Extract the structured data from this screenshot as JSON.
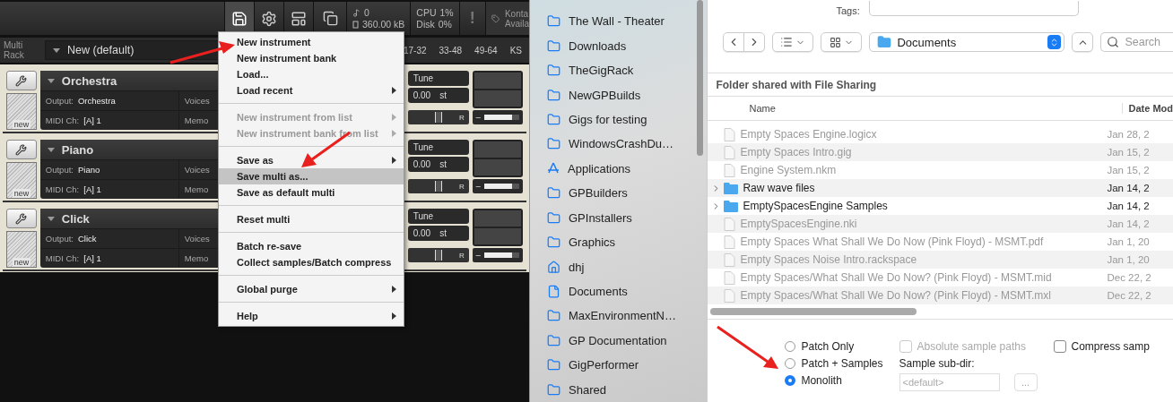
{
  "kontakt": {
    "toolbar": {
      "voices": "0",
      "memory": "360.00 kB",
      "cpu_label": "CPU",
      "cpu": "1%",
      "disk_label": "Disk",
      "disk": "0%",
      "warning": "!",
      "license_lines": [
        "Konta",
        "Availa"
      ],
      "save_active": true
    },
    "rack_label": "Multi Rack",
    "multi_name": "New (default)",
    "pages": [
      "17-32",
      "33-48",
      "49-64",
      "KS"
    ],
    "instruments": [
      {
        "name": "Orchestra",
        "output_label": "Output:",
        "output": "Orchestra",
        "voices_label": "Voices",
        "midi_label": "MIDI Ch:",
        "midi": "[A]  1",
        "memory_label": "Memo",
        "new_label": "new",
        "tune_label": "Tune",
        "tune": "0.00",
        "tune_unit": "st",
        "pan": {
          "label": "R",
          "level": 0.5
        },
        "volume": {
          "sign": "–",
          "level": 0.8
        }
      },
      {
        "name": "Piano",
        "output_label": "Output:",
        "output": "Piano",
        "voices_label": "Voices",
        "midi_label": "MIDI Ch:",
        "midi": "[A]  1",
        "memory_label": "Memo",
        "new_label": "new",
        "tune_label": "Tune",
        "tune": "0.00",
        "tune_unit": "st",
        "pan": {
          "label": "R",
          "level": 0.5
        },
        "volume": {
          "sign": "–",
          "level": 0.8
        }
      },
      {
        "name": "Click",
        "output_label": "Output:",
        "output": "Click",
        "voices_label": "Voices",
        "midi_label": "MIDI Ch:",
        "midi": "[A]  1",
        "memory_label": "Memo",
        "new_label": "new",
        "tune_label": "Tune",
        "tune": "0.00",
        "tune_unit": "st",
        "pan": {
          "label": "R",
          "level": 0.5
        },
        "volume": {
          "sign": "–",
          "level": 0.8
        }
      }
    ]
  },
  "menu": {
    "items": [
      {
        "kind": "item",
        "label": "New instrument",
        "disabled": false,
        "submenu": false,
        "selected": false
      },
      {
        "kind": "item",
        "label": "New instrument bank",
        "disabled": false,
        "submenu": false,
        "selected": false
      },
      {
        "kind": "item",
        "label": "Load...",
        "disabled": false,
        "submenu": false,
        "selected": false
      },
      {
        "kind": "item",
        "label": "Load recent",
        "disabled": false,
        "submenu": true,
        "selected": false
      },
      {
        "kind": "separator"
      },
      {
        "kind": "item",
        "label": "New instrument from list",
        "disabled": true,
        "submenu": true,
        "selected": false
      },
      {
        "kind": "item",
        "label": "New instrument bank from list",
        "disabled": true,
        "submenu": true,
        "selected": false
      },
      {
        "kind": "separator"
      },
      {
        "kind": "item",
        "label": "Save as",
        "disabled": false,
        "submenu": true,
        "selected": false
      },
      {
        "kind": "item",
        "label": "Save multi as...",
        "disabled": false,
        "submenu": false,
        "selected": true
      },
      {
        "kind": "item",
        "label": "Save as default multi",
        "disabled": false,
        "submenu": false,
        "selected": false
      },
      {
        "kind": "separator"
      },
      {
        "kind": "item",
        "label": "Reset multi",
        "disabled": false,
        "submenu": false,
        "selected": false
      },
      {
        "kind": "separator"
      },
      {
        "kind": "item",
        "label": "Batch re-save",
        "disabled": false,
        "submenu": false,
        "selected": false
      },
      {
        "kind": "item",
        "label": "Collect samples/Batch compress",
        "disabled": false,
        "submenu": false,
        "selected": false
      },
      {
        "kind": "separator"
      },
      {
        "kind": "item",
        "label": "Global purge",
        "disabled": false,
        "submenu": true,
        "selected": false
      },
      {
        "kind": "separator"
      },
      {
        "kind": "item",
        "label": "Help",
        "disabled": false,
        "submenu": true,
        "selected": false
      }
    ]
  },
  "sidebar": {
    "items": [
      {
        "kind": "folder",
        "label": "The Wall - Theater"
      },
      {
        "kind": "folder",
        "label": "Downloads"
      },
      {
        "kind": "folder",
        "label": "TheGigRack"
      },
      {
        "kind": "folder",
        "label": "NewGPBuilds"
      },
      {
        "kind": "folder",
        "label": "Gigs for testing"
      },
      {
        "kind": "folder",
        "label": "WindowsCrashDu…"
      },
      {
        "kind": "apps",
        "label": "Applications"
      },
      {
        "kind": "folder",
        "label": "GPBuilders"
      },
      {
        "kind": "folder",
        "label": "GPInstallers"
      },
      {
        "kind": "folder",
        "label": "Graphics"
      },
      {
        "kind": "home",
        "label": "dhj"
      },
      {
        "kind": "document",
        "label": "Documents"
      },
      {
        "kind": "folder",
        "label": "MaxEnvironmentN…"
      },
      {
        "kind": "folder",
        "label": "GP Documentation"
      },
      {
        "kind": "folder",
        "label": "GigPerformer"
      },
      {
        "kind": "folder",
        "label": "Shared"
      }
    ]
  },
  "dialog": {
    "tags_label": "Tags:",
    "location": "Documents",
    "search_placeholder": "Search",
    "section_title": "Folder shared with File Sharing",
    "columns": [
      "Name",
      "Date Mod"
    ],
    "rows": [
      {
        "kind": "file",
        "name": "Empty Spaces Engine.logicx",
        "date": "Jan 28, 2",
        "disabled": true
      },
      {
        "kind": "file",
        "name": "Empty Spaces Intro.gig",
        "date": "Jan 15, 2",
        "disabled": true
      },
      {
        "kind": "file",
        "name": "Engine System.nkm",
        "date": "Jan 15, 2",
        "disabled": true
      },
      {
        "kind": "folder",
        "name": "Raw wave files",
        "date": "Jan 14, 2",
        "disabled": false
      },
      {
        "kind": "folder",
        "name": "EmptySpacesEngine Samples",
        "date": "Jan 14, 2",
        "disabled": false
      },
      {
        "kind": "file",
        "name": "EmptySpacesEngine.nki",
        "date": "Jan 14, 2",
        "disabled": true
      },
      {
        "kind": "file",
        "name": "Empty Spaces What Shall We Do Now (Pink Floyd) - MSMT.pdf",
        "date": "Jan 1, 20",
        "disabled": true
      },
      {
        "kind": "file",
        "name": "Empty Spaces Noise Intro.rackspace",
        "date": "Jan 1, 20",
        "disabled": true
      },
      {
        "kind": "file",
        "name": "Empty Spaces/What Shall We Do Now? (Pink Floyd) - MSMT.mid",
        "date": "Dec 22, 2",
        "disabled": true
      },
      {
        "kind": "file",
        "name": "Empty Spaces/What Shall We Do Now? (Pink Floyd) - MSMT.mxl",
        "date": "Dec 22, 2",
        "disabled": true
      }
    ],
    "radios": [
      {
        "label": "Patch Only",
        "selected": false
      },
      {
        "label": "Patch + Samples",
        "selected": false
      },
      {
        "label": "Monolith",
        "selected": true
      }
    ],
    "checkboxes": [
      {
        "label": "Absolute sample paths",
        "checked": false,
        "disabled": true
      },
      {
        "label": "Compress samp",
        "checked": false,
        "disabled": false
      }
    ],
    "subdir_label": "Sample sub-dir:",
    "subdir_placeholder": "<default>",
    "browse_button": "..."
  }
}
